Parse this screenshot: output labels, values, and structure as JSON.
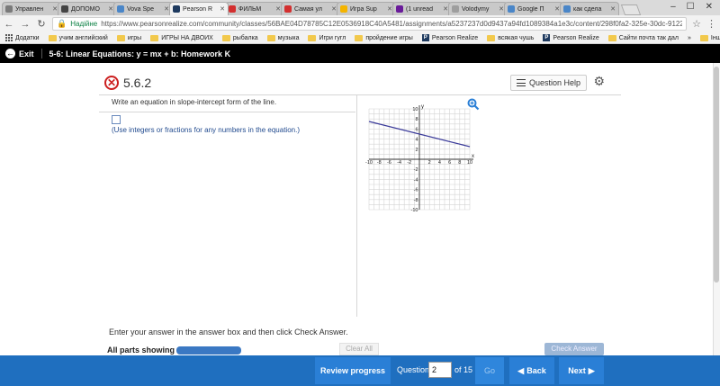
{
  "browser": {
    "tabs": [
      {
        "label": "Управлен",
        "color": "#7a7a7a",
        "active": false
      },
      {
        "label": "ДОПОМО",
        "color": "#444444",
        "active": false
      },
      {
        "label": "Vova Spe",
        "color": "#4a86c8",
        "active": false
      },
      {
        "label": "Pearson R",
        "color": "#1e3a5f",
        "active": true
      },
      {
        "label": "ФИЛЬМ",
        "color": "#d32f2f",
        "active": false
      },
      {
        "label": "Самая ул",
        "color": "#d32f2f",
        "active": false
      },
      {
        "label": "Игра Sup",
        "color": "#f4b400",
        "active": false
      },
      {
        "label": "(1 unread",
        "color": "#6a1b9a",
        "active": false
      },
      {
        "label": "Volodymy",
        "color": "#9e9e9e",
        "active": false
      },
      {
        "label": "Google П",
        "color": "#4a86c8",
        "active": false
      },
      {
        "label": "как сдела",
        "color": "#4a86c8",
        "active": false
      }
    ],
    "secure_label": "Надійне",
    "url": "https://www.pearsonrealize.com/community/classes/56BAE04D78785C12E0536918C40A5481/assignments/a5237237d0d9437a94fd1089384a1e3c/content/298f0fa2-325e-30dc-9122-d227...",
    "bookmarks": [
      {
        "label": "Додатки",
        "type": "apps"
      },
      {
        "label": "учим английский",
        "type": "folder"
      },
      {
        "label": "игры",
        "type": "folder"
      },
      {
        "label": "ИГРЫ НА ДВОИХ",
        "type": "folder"
      },
      {
        "label": "рыбалка",
        "type": "folder"
      },
      {
        "label": "музыка",
        "type": "folder"
      },
      {
        "label": "Игри гугл",
        "type": "folder"
      },
      {
        "label": "пройдение игры",
        "type": "folder"
      },
      {
        "label": "Pearson Realize",
        "type": "pearson"
      },
      {
        "label": "всякая чушь",
        "type": "folder"
      },
      {
        "label": "Pearson Realize",
        "type": "pearson"
      },
      {
        "label": "Сайти почта так дал",
        "type": "folder"
      }
    ],
    "bookmarks_overflow": "»",
    "other_bookmarks": "Інші закладки"
  },
  "assignment": {
    "exit_label": "Exit",
    "title": "5-6: Linear Equations: y = mx + b: Homework K"
  },
  "question": {
    "number": "5.6.2",
    "help_label": "Question Help",
    "prompt": "Write an equation in slope-intercept form of the line.",
    "hint": "(Use integers or fractions for any numbers in the equation.)"
  },
  "graph": {
    "x_label": "x",
    "y_label": "y",
    "x_ticks": [
      "-10",
      "-8",
      "-6",
      "-4",
      "-2",
      "2",
      "4",
      "6",
      "8",
      "10"
    ],
    "y_ticks": [
      "10",
      "8",
      "6",
      "4",
      "2",
      "-2",
      "-4",
      "-6",
      "-8",
      "-10"
    ],
    "range": [
      -10,
      10
    ],
    "line": {
      "x1": -10,
      "y1": 7.5,
      "x2": 10,
      "y2": 2.5
    },
    "line_color": "#3b3b9a"
  },
  "bottom": {
    "instruction": "Enter your answer in the answer box and then click Check Answer.",
    "parts_label": "All parts showing",
    "clear_label": "Clear All",
    "check_label": "Check Answer"
  },
  "footer": {
    "review_label": "Review progress",
    "question_label": "Question",
    "question_value": "2",
    "of_label": "of 15",
    "go_label": "Go",
    "back_label": "Back",
    "next_label": "Next"
  },
  "colors": {
    "footer_bg": "#1f6fbf",
    "button_bg": "#2a7fd6",
    "error_red": "#cc1f1f"
  }
}
